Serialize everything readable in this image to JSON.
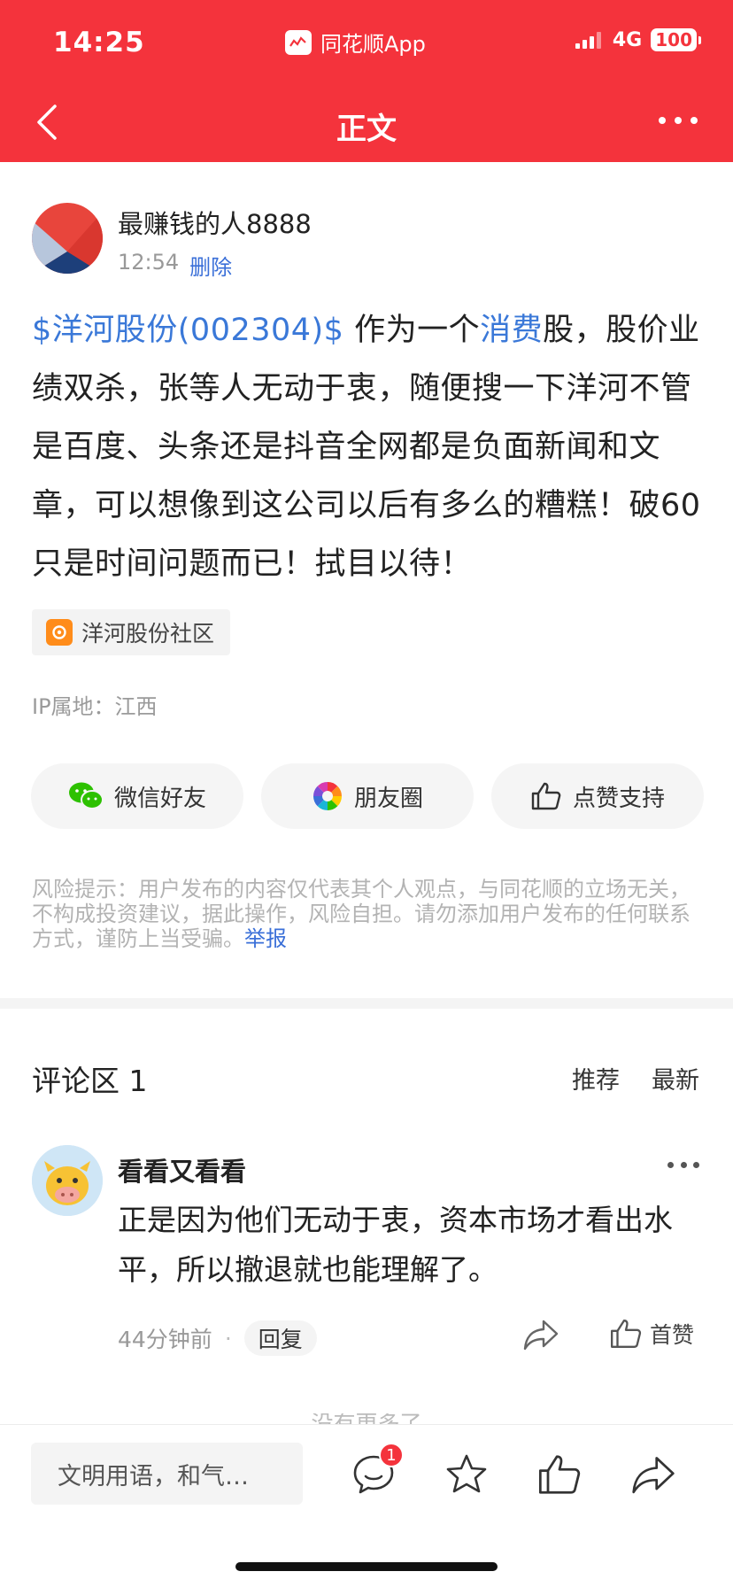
{
  "status_bar": {
    "time": "14:25",
    "app_name": "同花顺App",
    "network": "4G",
    "battery": "100"
  },
  "nav": {
    "title": "正文"
  },
  "post": {
    "author": "最赚钱的人8888",
    "time": "12:54",
    "delete_label": "删除",
    "body": {
      "stock_link": "$洋河股份(002304)$",
      "text_1": " 作为一个",
      "topic_link": "消费",
      "text_2": "股，股价业绩双杀，张等人无动于衷，随便搜一下洋河不管是百度、头条还是抖音全网都是负面新闻和文章，可以想像到这公司以后有多么的糟糕！破60只是时间问题而已！拭目以待！"
    },
    "community_tag": "洋河股份社区",
    "ip_location": "IP属地：江西"
  },
  "share": {
    "wechat_label": "微信好友",
    "moments_label": "朋友圈",
    "like_label": "点赞支持"
  },
  "risk_notice": {
    "text": "风险提示：用户发布的内容仅代表其个人观点，与同花顺的立场无关，不构成投资建议，据此操作，风险自担。请勿添加用户发布的任何联系方式，谨防上当受骗。",
    "report_label": "举报"
  },
  "comments": {
    "title": "评论区 1",
    "sort_recommend": "推荐",
    "sort_latest": "最新",
    "items": [
      {
        "user": "看看又看看",
        "text": "正是因为他们无动于衷，资本市场才看出水平，所以撤退就也能理解了。",
        "time": "44分钟前",
        "reply_label": "回复",
        "like_label": "首赞"
      }
    ],
    "no_more": "没有更多了"
  },
  "bottom_bar": {
    "input_placeholder": "文明用语，和气…",
    "comment_badge": "1"
  },
  "colors": {
    "brand_red": "#f4333c",
    "link_blue": "#3a78d8",
    "wechat_green": "#2dc100",
    "community_orange": "#ff8c1a"
  },
  "icons": [
    "back-arrow-icon",
    "more-icon",
    "wechat-icon",
    "moments-icon",
    "thumbs-up-icon",
    "share-icon",
    "comment-icon",
    "star-icon"
  ]
}
